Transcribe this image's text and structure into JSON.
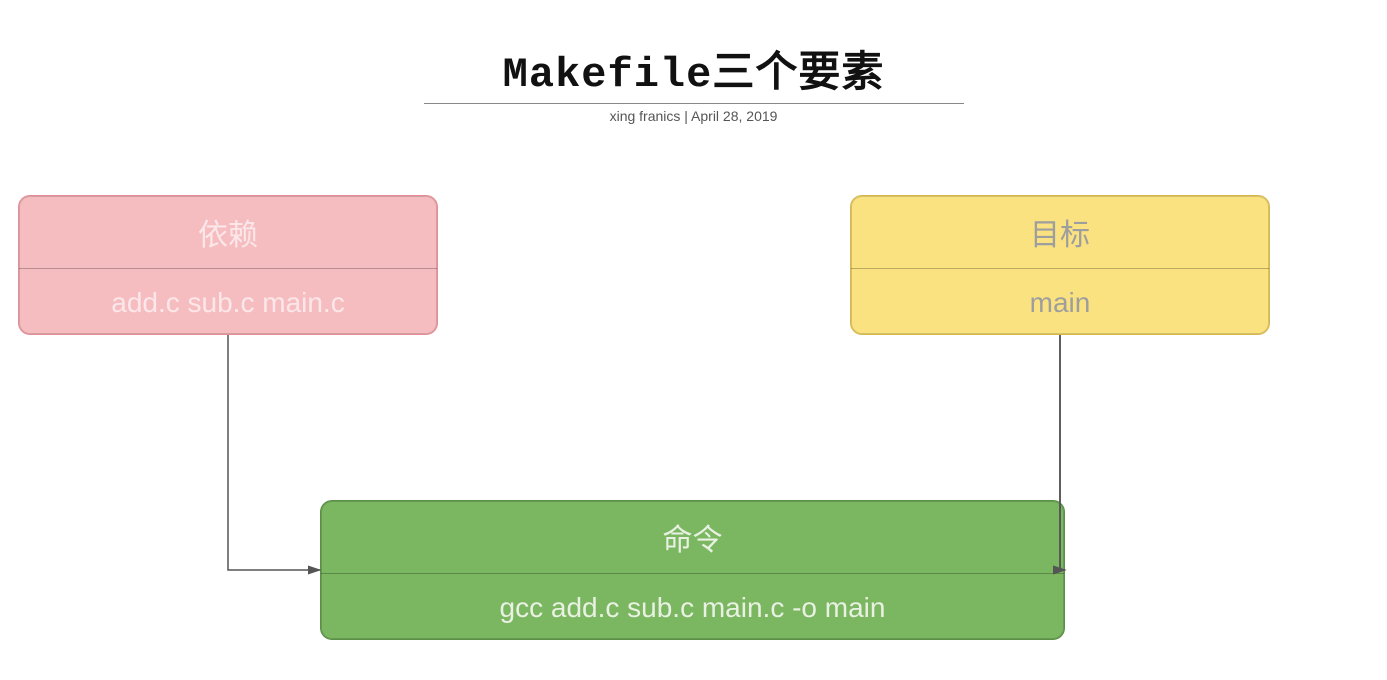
{
  "title_mono": "Makefile",
  "title_rest": "三个要素",
  "byline": "xing franics  |  April 28, 2019",
  "nodes": {
    "dependency": {
      "label": "依赖",
      "content": "add.c sub.c main.c"
    },
    "target": {
      "label": "目标",
      "content": "main"
    },
    "command": {
      "label": "命令",
      "content": "gcc add.c sub.c main.c -o main"
    }
  },
  "colors": {
    "dependency": "#f6bdc0",
    "target": "#fbe281",
    "command": "#7bb661"
  }
}
